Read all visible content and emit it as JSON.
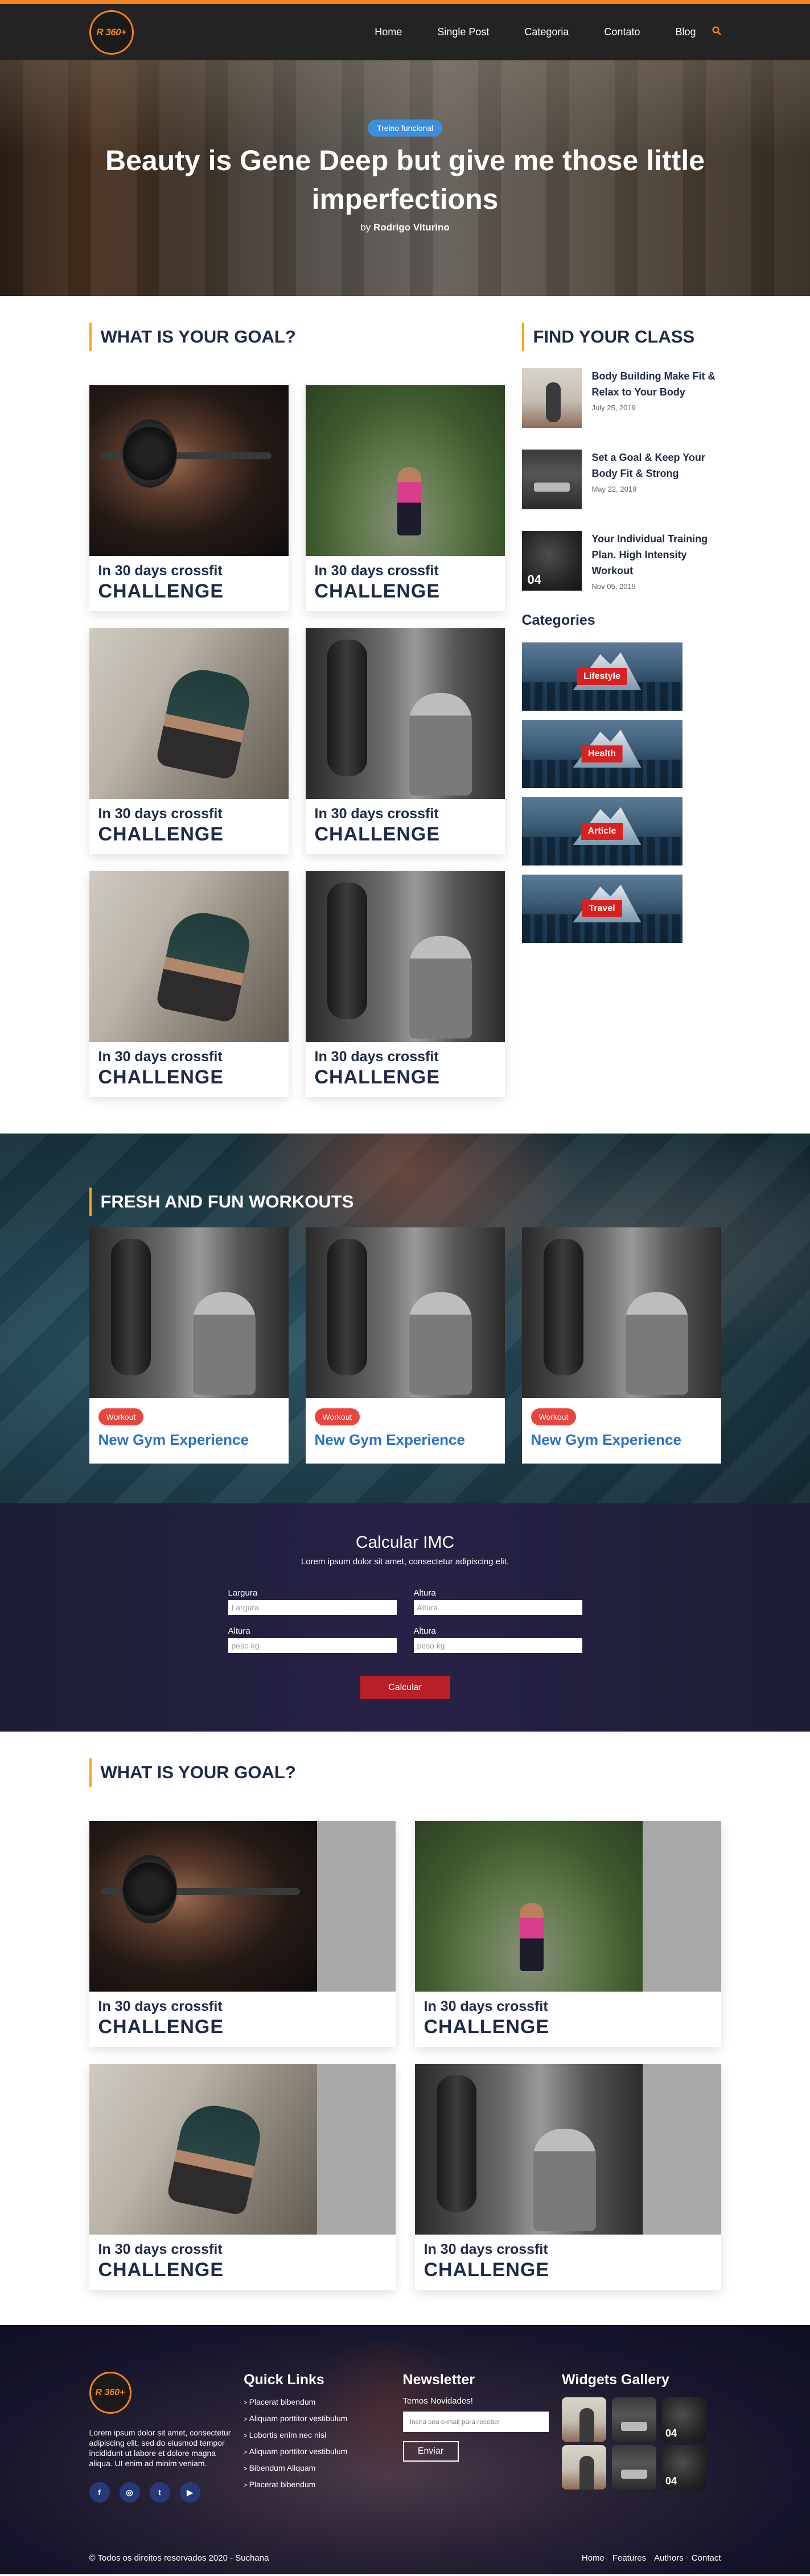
{
  "header": {
    "logo_text": "R 360+",
    "nav": [
      "Home",
      "Single Post",
      "Categoria",
      "Contato",
      "Blog"
    ]
  },
  "hero": {
    "tag": "Treino funcional",
    "title": "Beauty is Gene Deep but give me those little imperfections",
    "by_prefix": "by",
    "author": "Rodrigo Viturino"
  },
  "goal": {
    "title": "WHAT IS YOUR GOAL?",
    "cards": [
      {
        "small": "In 30 days crossfit",
        "big": "CHALLENGE",
        "photo": "barbell"
      },
      {
        "small": "In 30 days crossfit",
        "big": "CHALLENGE",
        "photo": "park"
      },
      {
        "small": "In 30 days crossfit",
        "big": "CHALLENGE",
        "photo": "stretch"
      },
      {
        "small": "In 30 days crossfit",
        "big": "CHALLENGE",
        "photo": "boxing"
      },
      {
        "small": "In 30 days crossfit",
        "big": "CHALLENGE",
        "photo": "stretch"
      },
      {
        "small": "In 30 days crossfit",
        "big": "CHALLENGE",
        "photo": "boxing"
      }
    ]
  },
  "sidebar": {
    "title": "FIND YOUR CLASS",
    "posts": [
      {
        "title": "Body Building Make Fit & Relax to Your Body",
        "date": "July 25, 2019",
        "num": ""
      },
      {
        "title": "Set a Goal & Keep Your Body Fit & Strong",
        "date": "May 22, 2019",
        "num": ""
      },
      {
        "title": "Your Individual Training Plan. High Intensity Workout",
        "date": "Nov 05, 2019",
        "num": "04"
      }
    ],
    "categories_title": "Categories",
    "categories": [
      "Lifestyle",
      "Health",
      "Article",
      "Travel"
    ]
  },
  "workouts": {
    "title": "FRESH AND FUN WORKOUTS",
    "cards": [
      {
        "tag": "Workout",
        "title": "New Gym Experience"
      },
      {
        "tag": "Workout",
        "title": "New Gym Experience"
      },
      {
        "tag": "Workout",
        "title": "New Gym Experience"
      }
    ]
  },
  "imc": {
    "title": "Calcular IMC",
    "subtitle": "Lorem ipsum dolor sit amet, consectetur adipiscing elit.",
    "fields": [
      {
        "label": "Largura",
        "placeholder": "Largura"
      },
      {
        "label": "Altura",
        "placeholder": "Altura"
      },
      {
        "label": "Altura",
        "placeholder": "peso kg"
      },
      {
        "label": "Altura",
        "placeholder": "peso kg"
      }
    ],
    "button": "Calcular"
  },
  "goal2": {
    "title": "WHAT IS YOUR GOAL?",
    "cards": [
      {
        "small": "In 30 days crossfit",
        "big": "CHALLENGE",
        "photo": "barbell"
      },
      {
        "small": "In 30 days crossfit",
        "big": "CHALLENGE",
        "photo": "park"
      },
      {
        "small": "In 30 days crossfit",
        "big": "CHALLENGE",
        "photo": "stretch"
      },
      {
        "small": "In 30 days crossfit",
        "big": "CHALLENGE",
        "photo": "boxing"
      }
    ]
  },
  "footer": {
    "logo_text": "R 360+",
    "about": "Lorem ipsum dolor sit amet, consectetur adipiscing elit, sed do eiusmod tempor incididunt ut labore et dolore magna aliqua. Ut enim ad minim veniam.",
    "social": [
      "f",
      "◎",
      "t",
      "▶"
    ],
    "quick_title": "Quick Links",
    "quick_links": [
      "Placerat bibendum",
      "Aliquam porttitor vestibulum",
      "Lobortis enim nec nisi",
      "Aliquam porttitor vestibulum",
      "Bibendum Aliquam",
      "Placerat bibendum"
    ],
    "news_title": "Newsletter",
    "news_text": "Temos Novidades!",
    "news_placeholder": "Insira seu e-mail para receber",
    "news_button": "Enviar",
    "gallery_title": "Widgets Gallery",
    "gallery_nums": [
      "",
      "",
      "04",
      "",
      "",
      "04"
    ],
    "copyright": "© Todos os direitos reservados 2020 - Suchana",
    "bottom_nav": [
      "Home",
      "Features",
      "Authors",
      "Contact"
    ]
  }
}
